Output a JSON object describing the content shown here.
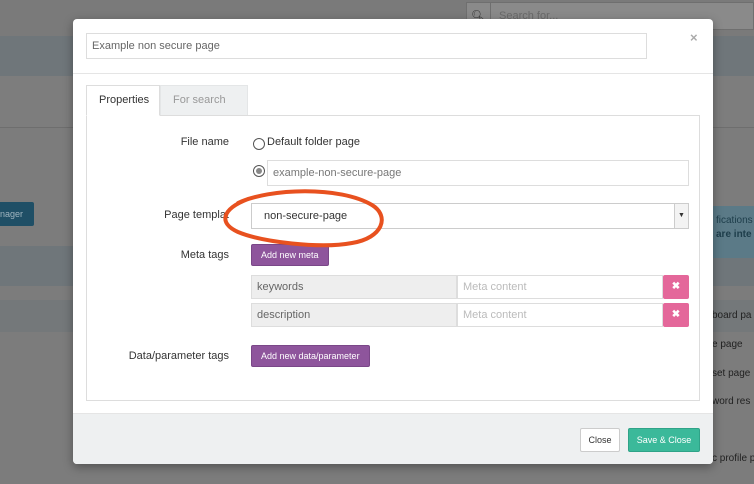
{
  "background": {
    "search_placeholder": "Search for...",
    "manager_button": "nager",
    "info_line1": "fications",
    "info_line2": "are inte",
    "right_list": [
      "board pa",
      "e page",
      "set page",
      "word res",
      "c profile p"
    ]
  },
  "modal": {
    "title_value": "Example non secure page",
    "close_glyph": "×",
    "tabs": [
      {
        "label": "Properties",
        "active": true
      },
      {
        "label": "For search",
        "active": false
      }
    ],
    "file_name": {
      "label": "File name",
      "option_default": "Default folder page",
      "custom_value": "example-non-secure-page",
      "selected": "custom"
    },
    "page_template": {
      "label": "Page templat",
      "selected": "non-secure-page"
    },
    "meta_tags": {
      "label": "Meta tags",
      "add_button": "Add new meta",
      "rows": [
        {
          "key": "keywords",
          "content_placeholder": "Meta content"
        },
        {
          "key": "description",
          "content_placeholder": "Meta content"
        }
      ],
      "delete_glyph": "✖"
    },
    "data_tags": {
      "label": "Data/parameter tags",
      "add_button": "Add new data/parameter"
    },
    "footer": {
      "close_button": "Close",
      "save_button": "Save & Close"
    }
  },
  "colors": {
    "purple": "#8e559c",
    "teal": "#3bb99a",
    "pink": "#e4679a",
    "annotation": "#e8511f"
  }
}
